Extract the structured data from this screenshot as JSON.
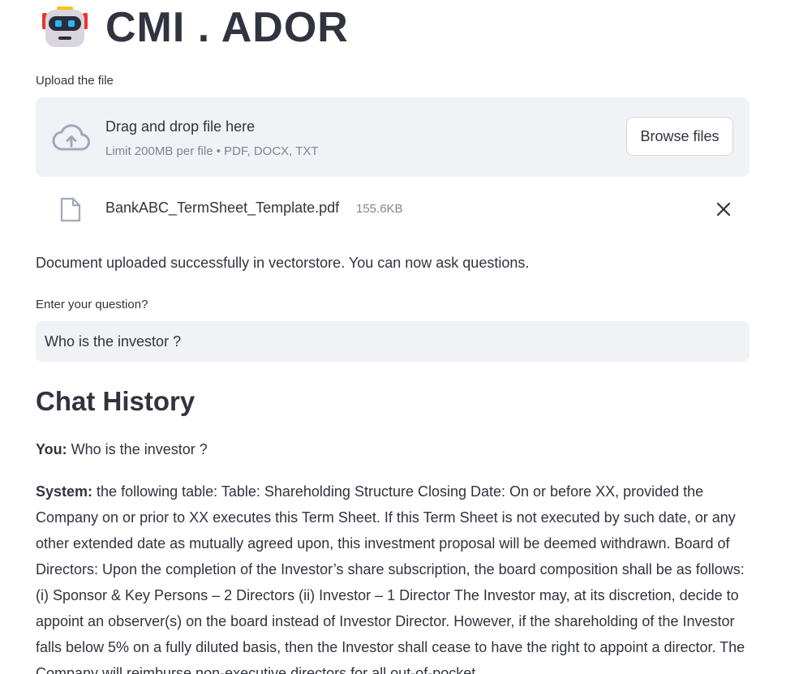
{
  "app": {
    "title": "CMI . ADOR",
    "logo_icon": "robot-icon"
  },
  "upload": {
    "label": "Upload the file",
    "drop_title": "Drag and drop file here",
    "drop_limit": "Limit 200MB per file • PDF, DOCX, TXT",
    "browse_label": "Browse files",
    "file": {
      "name": "BankABC_TermSheet_Template.pdf",
      "size": "155.6KB"
    }
  },
  "status": {
    "message": "Document uploaded successfully in vectorstore. You can now ask questions."
  },
  "question": {
    "label": "Enter your question?",
    "value": "Who is the investor ?"
  },
  "chat": {
    "title": "Chat History",
    "messages": [
      {
        "speaker": "You:",
        "text": "Who is the investor ?"
      },
      {
        "speaker": "System:",
        "text": "the following table: Table: Shareholding Structure Closing Date: On or before XX, provided the Company on or prior to XX executes this Term Sheet. If this Term Sheet is not executed by such date, or any other extended date as mutually agreed upon, this investment proposal will be deemed withdrawn. Board of Directors: Upon the completion of the Investor’s share subscription, the board composition shall be as follows: (i) Sponsor & Key Persons – 2 Directors (ii) Investor – 1 Director The Investor may, at its discretion, decide to appoint an observer(s) on the board instead of Investor Director. However, if the shareholding of the Investor falls below 5% on a fully diluted basis, then the Investor shall cease to have the right to appoint a director. The Company will reimburse non-executive directors for all out-of-pocket"
      }
    ]
  },
  "colors": {
    "text": "#31333f",
    "muted": "#808495",
    "panel": "#f0f2f6",
    "robot_accent": "#e8372b",
    "robot_eyes": "#29b6f6"
  }
}
